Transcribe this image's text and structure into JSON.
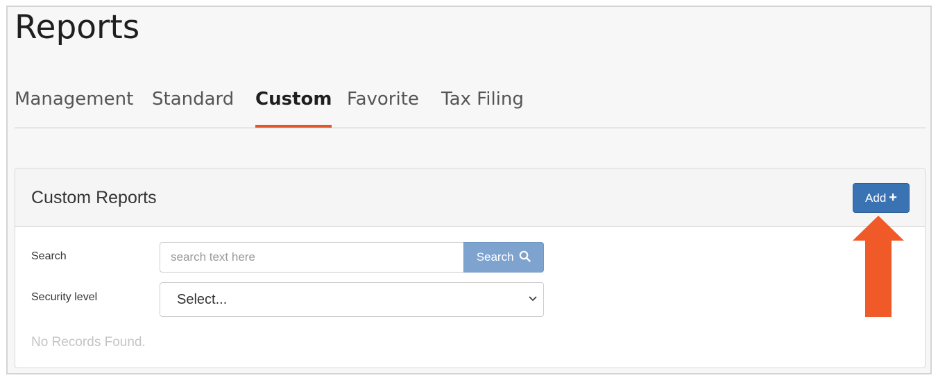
{
  "page": {
    "title": "Reports"
  },
  "tabs": [
    {
      "label": "Management",
      "active": false
    },
    {
      "label": "Standard",
      "active": false
    },
    {
      "label": "Custom",
      "active": true
    },
    {
      "label": "Favorite",
      "active": false
    },
    {
      "label": "Tax Filing",
      "active": false
    }
  ],
  "panel": {
    "title": "Custom Reports",
    "add_label": "Add",
    "add_icon": "plus-icon"
  },
  "filters": {
    "search_label": "Search",
    "search_placeholder": "search text here",
    "search_value": "",
    "search_button_label": "Search",
    "search_button_icon": "magnifier-icon",
    "security_label": "Security level",
    "security_selected": "Select..."
  },
  "empty_text": "No Records Found.",
  "colors": {
    "accent_underline": "#e4562a",
    "primary_button": "#3a73b4",
    "search_button": "#7ea3cf",
    "annotation_arrow": "#f05a28"
  }
}
